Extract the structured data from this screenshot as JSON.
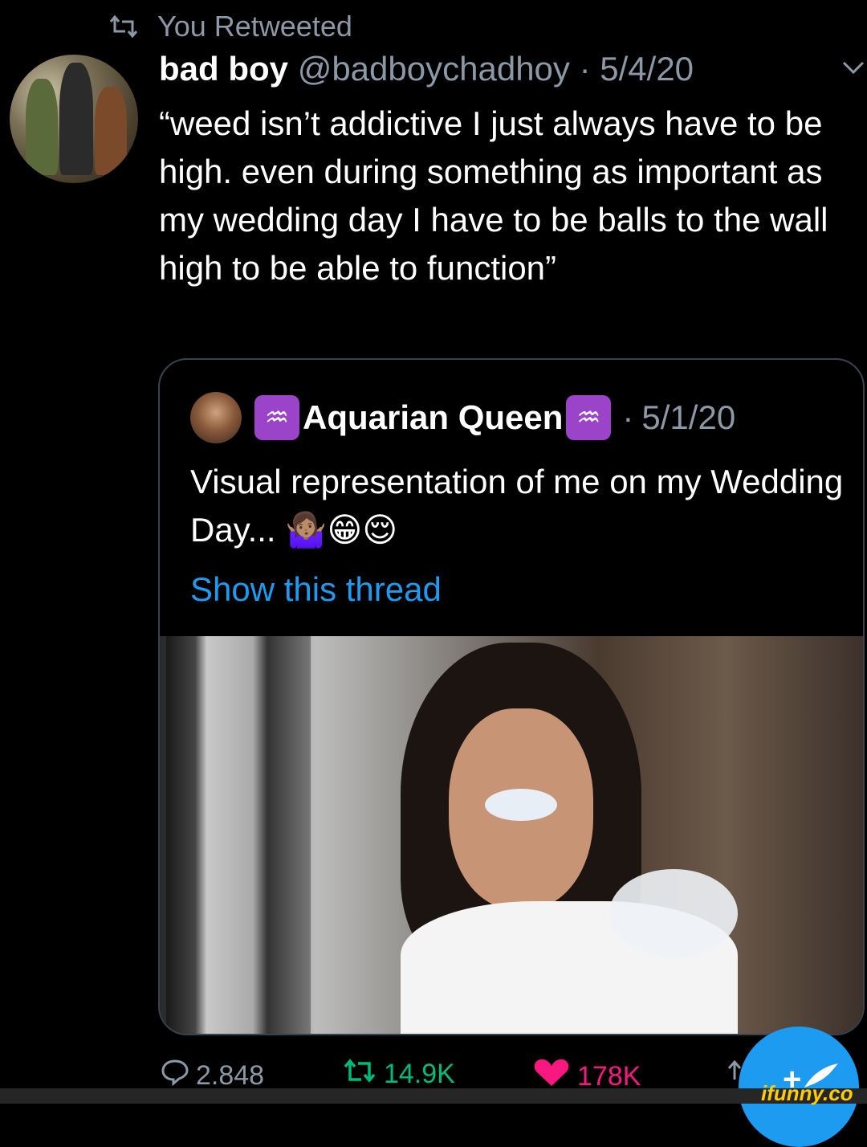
{
  "retweet_banner": {
    "text": "You Retweeted",
    "icon": "retweet-icon"
  },
  "tweet": {
    "name": "bad boy",
    "handle": "@badboychadhoy",
    "separator": "·",
    "date": "5/4/20",
    "text": "“weed isn’t addictive I just always have to be high. even during something as important as my wedding day I have to be balls to the wall high to be able to function”"
  },
  "quoted_tweet": {
    "zodiac_glyph": "♒",
    "name": "Aquarian Queen",
    "separator": "·",
    "date": "5/1/20",
    "text": "Visual representation of me on my Wedding Day... 🤷🏽‍♀️😁😌",
    "show_thread": "Show this thread",
    "image_icon": "photo"
  },
  "actions": {
    "replies": "2.848",
    "retweets": "14.9K",
    "likes": "178K"
  },
  "fab": {
    "label": "+"
  },
  "watermark": "ifunny.co",
  "colors": {
    "background": "#000000",
    "muted": "#8b98a5",
    "link": "#1d9bf0",
    "retweet": "#00ba7c",
    "like": "#f91880",
    "zodiac": "#9b44c9"
  }
}
